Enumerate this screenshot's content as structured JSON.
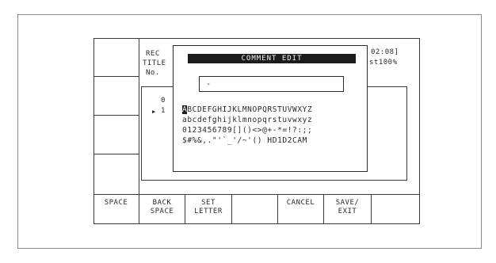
{
  "header": {
    "rec_label": "REC",
    "title_label": "TITLE",
    "no_label": "No.",
    "time_text": "02:08]",
    "percent_text": "st100%"
  },
  "list": {
    "rows": [
      "0",
      "1"
    ],
    "selected_marker": "▶"
  },
  "dialog": {
    "title": "COMMENT EDIT",
    "field_value": "-",
    "char_rows": [
      {
        "cursor_char": "A",
        "rest": "BCDEFGHIJKLMNOPQRSTUVWXYZ"
      },
      {
        "cursor_char": "",
        "rest": "abcdefghijklmnopqrstuvwxyz"
      },
      {
        "cursor_char": "",
        "rest": "0123456789[]()<>@+-*=!?:;;"
      },
      {
        "cursor_char": "",
        "rest": "$#%&,.\"'`_'/~'()   HD1D2CAM"
      }
    ]
  },
  "softkeys": [
    {
      "label": "SPACE"
    },
    {
      "label": "BACK\nSPACE"
    },
    {
      "label": "SET\nLETTER"
    },
    {
      "label": ""
    },
    {
      "label": "CANCEL"
    },
    {
      "label": "SAVE/\nEXIT"
    },
    {
      "label": ""
    }
  ]
}
